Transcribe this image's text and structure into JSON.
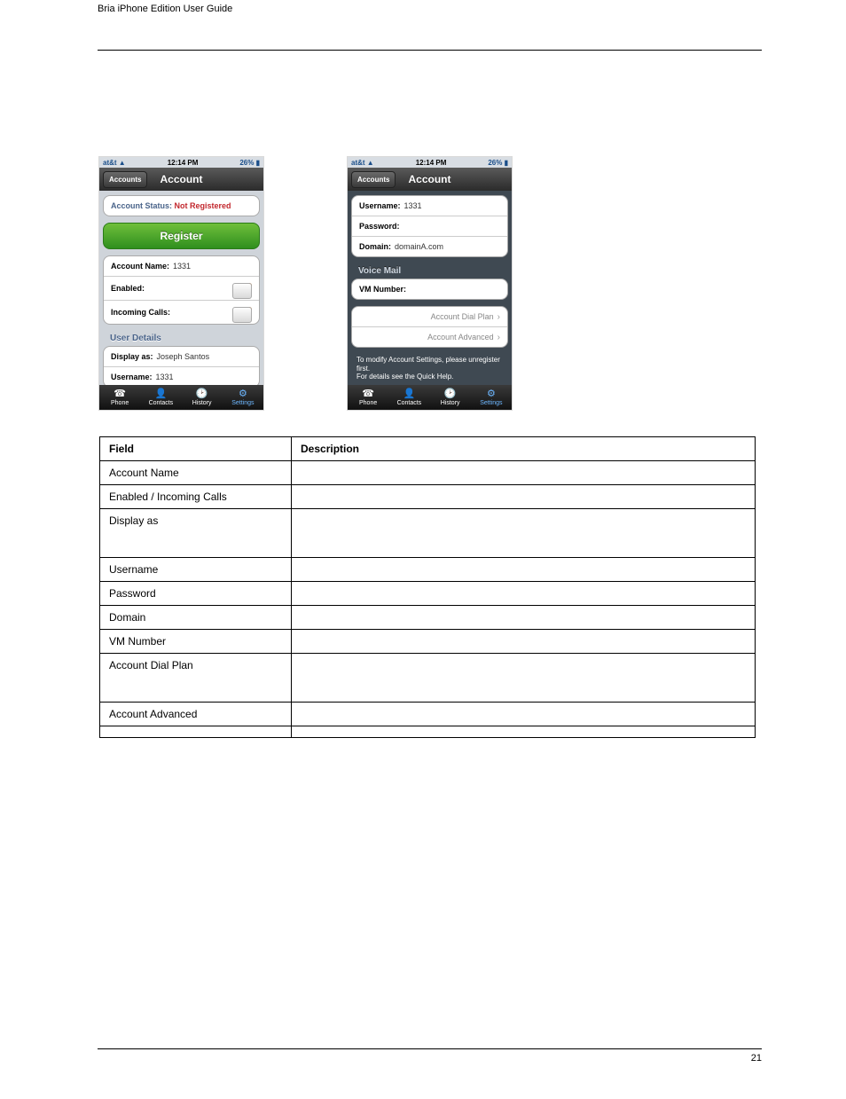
{
  "header": {
    "left": "Bria iPhone Edition User Guide",
    "right": ""
  },
  "footer": {
    "left": "",
    "right": "21"
  },
  "phone1": {
    "status": {
      "carrier": "at&t",
      "time": "12:14 PM",
      "battery": "26%"
    },
    "nav": {
      "back": "Accounts",
      "title": "Account"
    },
    "accountStatusLabel": "Account Status:",
    "accountStatusValue": "Not Registered",
    "registerLabel": "Register",
    "rows": {
      "accountName": {
        "label": "Account Name:",
        "value": "1331"
      },
      "enabled": {
        "label": "Enabled:",
        "value": "ON"
      },
      "incoming": {
        "label": "Incoming Calls:",
        "value": "ON"
      }
    },
    "userDetailsHeader": "User Details",
    "displayAs": {
      "label": "Display as:",
      "value": "Joseph Santos"
    },
    "username": {
      "label": "Username:",
      "value": "1331"
    },
    "tabs": {
      "phone": "Phone",
      "contacts": "Contacts",
      "history": "History",
      "settings": "Settings"
    }
  },
  "phone2": {
    "status": {
      "carrier": "at&t",
      "time": "12:14 PM",
      "battery": "26%"
    },
    "nav": {
      "back": "Accounts",
      "title": "Account"
    },
    "rows": {
      "username": {
        "label": "Username:",
        "value": "1331"
      },
      "password": {
        "label": "Password:",
        "value": ""
      },
      "domain": {
        "label": "Domain:",
        "value": "domainA.com"
      }
    },
    "voiceMailHeader": "Voice Mail",
    "vmNumber": {
      "label": "VM Number:",
      "value": ""
    },
    "links": {
      "dialPlan": "Account Dial Plan",
      "advanced": "Account Advanced"
    },
    "note1": "To modify Account Settings, please unregister first.",
    "note2": "For details see the Quick Help.",
    "tabs": {
      "phone": "Phone",
      "contacts": "Contacts",
      "history": "History",
      "settings": "Settings"
    }
  },
  "table": {
    "headers": {
      "field": "Field",
      "desc": "Description"
    },
    "rows": [
      {
        "field": "Account Name",
        "desc": ""
      },
      {
        "field": "Enabled / Incoming Calls",
        "desc": ""
      },
      {
        "field": "Display as",
        "desc": "",
        "tall": true
      },
      {
        "field": "Username",
        "desc": ""
      },
      {
        "field": "Password",
        "desc": ""
      },
      {
        "field": "Domain",
        "desc": ""
      },
      {
        "field": "VM Number",
        "desc": ""
      },
      {
        "field": "Account Dial Plan",
        "desc": "",
        "tall": true
      },
      {
        "field": "Account Advanced",
        "desc": ""
      },
      {
        "field": "",
        "desc": ""
      }
    ]
  }
}
